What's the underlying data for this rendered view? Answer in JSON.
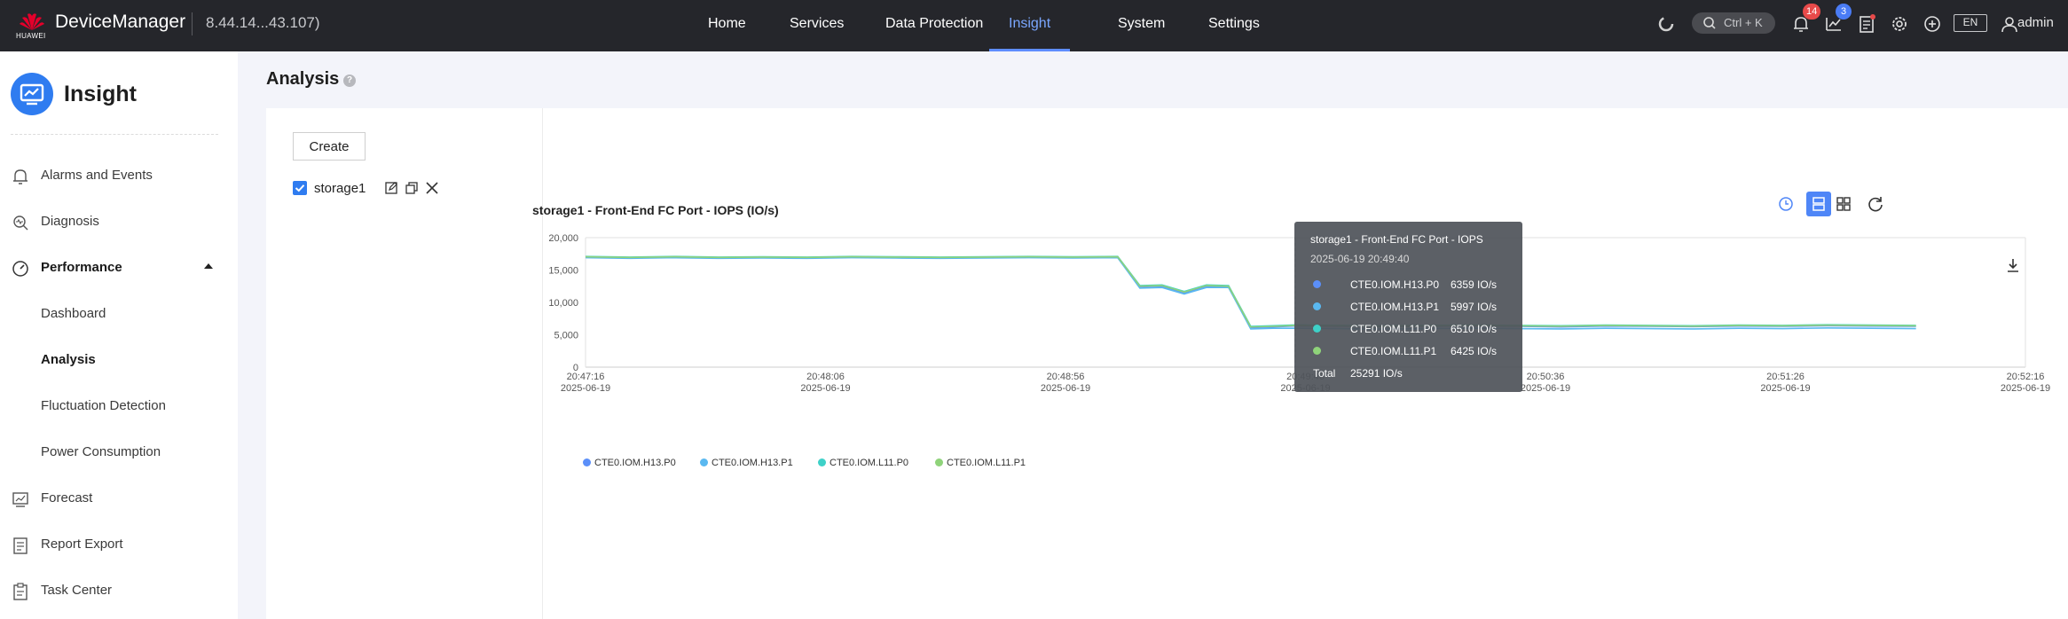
{
  "topbar": {
    "brand": "HUAWEI",
    "app_name": "DeviceManager",
    "ip": "8.44.14...43.107)",
    "nav": [
      "Home",
      "Services",
      "Data Protection",
      "Insight",
      "System",
      "Settings"
    ],
    "active_nav": "Insight",
    "search_placeholder": "Ctrl + K",
    "alarm_count": "14",
    "task_count": "3",
    "language": "EN",
    "user": "admin"
  },
  "sidebar": {
    "title": "Insight",
    "items": [
      {
        "label": "Alarms and Events",
        "icon": "bell-icon"
      },
      {
        "label": "Diagnosis",
        "icon": "diagnosis-icon"
      },
      {
        "label": "Performance",
        "icon": "gauge-icon"
      },
      {
        "label": "Dashboard"
      },
      {
        "label": "Analysis"
      },
      {
        "label": "Fluctuation Detection"
      },
      {
        "label": "Power Consumption"
      },
      {
        "label": "Forecast",
        "icon": "forecast-icon"
      },
      {
        "label": "Report Export",
        "icon": "report-icon"
      },
      {
        "label": "Task Center",
        "icon": "task-icon"
      }
    ]
  },
  "main": {
    "page_title": "Analysis",
    "create_label": "Create",
    "storage_item": "storage1"
  },
  "chart_data": {
    "type": "line",
    "title": "storage1 - Front-End FC Port - IOPS (IO/s)",
    "ylim": [
      0,
      20000
    ],
    "yticks": [
      "20,000",
      "15,000",
      "10,000",
      "5,000",
      "0"
    ],
    "xticks": [
      {
        "time": "20:47:16",
        "date": "2025-06-19"
      },
      {
        "time": "20:48:06",
        "date": "2025-06-19"
      },
      {
        "time": "20:48:56",
        "date": "2025-06-19"
      },
      {
        "time": "20:49:46",
        "date": "2025-06-19"
      },
      {
        "time": "20:50:36",
        "date": "2025-06-19"
      },
      {
        "time": "20:51:26",
        "date": "2025-06-19"
      },
      {
        "time": "20:52:16",
        "date": "2025-06-19"
      }
    ],
    "x_seconds_from_start": [
      0,
      10,
      20,
      30,
      40,
      50,
      60,
      70,
      80,
      90,
      100,
      110,
      120,
      125,
      130,
      135,
      140,
      145,
      150,
      155,
      160,
      170,
      180,
      190,
      200,
      210,
      220,
      230,
      240,
      250,
      260,
      270,
      280,
      290,
      300
    ],
    "series": [
      {
        "name": "CTE0.IOM.H13.P0",
        "color": "#5b8ff9",
        "values": [
          17000,
          16900,
          17000,
          16900,
          16950,
          16900,
          17000,
          16950,
          16900,
          16950,
          17000,
          16950,
          17000,
          12400,
          12500,
          11500,
          12500,
          12400,
          6100,
          6200,
          6359,
          6300,
          6250,
          6300,
          6350,
          6300,
          6200,
          6350,
          6300,
          6250,
          6350,
          6300,
          6400,
          6350,
          6300
        ]
      },
      {
        "name": "CTE0.IOM.H13.P1",
        "color": "#5ab8f0",
        "values": [
          16900,
          16800,
          16900,
          16800,
          16850,
          16800,
          16900,
          16850,
          16800,
          16850,
          16900,
          16850,
          16900,
          12200,
          12300,
          11300,
          12300,
          12300,
          5900,
          6000,
          5997,
          5950,
          5900,
          5950,
          6000,
          5950,
          5900,
          6000,
          5950,
          5900,
          6000,
          5950,
          6050,
          6000,
          5950
        ]
      },
      {
        "name": "CTE0.IOM.L11.P0",
        "color": "#3ed1c8",
        "values": [
          17100,
          17000,
          17100,
          17000,
          17050,
          17000,
          17100,
          17050,
          17000,
          17050,
          17100,
          17050,
          17100,
          12600,
          12700,
          11700,
          12700,
          12600,
          6300,
          6400,
          6510,
          6450,
          6400,
          6450,
          6500,
          6450,
          6400,
          6500,
          6450,
          6400,
          6500,
          6450,
          6550,
          6500,
          6450
        ]
      },
      {
        "name": "CTE0.IOM.L11.P1",
        "color": "#8fd37a",
        "values": [
          17050,
          16950,
          17050,
          16950,
          17000,
          16950,
          17050,
          17000,
          16950,
          17000,
          17050,
          17000,
          17050,
          12500,
          12600,
          11600,
          12600,
          12500,
          6200,
          6300,
          6425,
          6380,
          6330,
          6380,
          6430,
          6380,
          6330,
          6430,
          6380,
          6330,
          6430,
          6380,
          6480,
          6430,
          6380
        ]
      }
    ],
    "tooltip": {
      "title": "storage1 - Front-End FC Port - IOPS",
      "time": "2025-06-19 20:49:40",
      "rows": [
        {
          "name": "CTE0.IOM.H13.P0",
          "value": "6359 IO/s",
          "color": "#5b8ff9"
        },
        {
          "name": "CTE0.IOM.H13.P1",
          "value": "5997 IO/s",
          "color": "#5ab8f0"
        },
        {
          "name": "CTE0.IOM.L11.P0",
          "value": "6510 IO/s",
          "color": "#3ed1c8"
        },
        {
          "name": "CTE0.IOM.L11.P1",
          "value": "6425 IO/s",
          "color": "#8fd37a"
        }
      ],
      "total_label": "Total",
      "total_value": "25291 IO/s"
    },
    "legend": [
      "CTE0.IOM.H13.P0",
      "CTE0.IOM.H13.P1",
      "CTE0.IOM.L11.P0",
      "CTE0.IOM.L11.P1"
    ],
    "legend_placement": "bottom-left",
    "grid": false
  }
}
